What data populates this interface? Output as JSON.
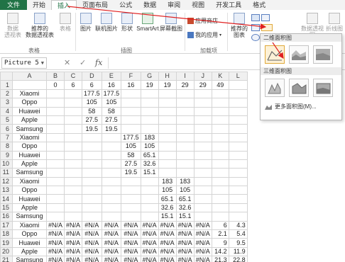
{
  "tabs": [
    "文件",
    "开始",
    "插入",
    "页面布局",
    "公式",
    "数据",
    "审阅",
    "视图",
    "开发工具",
    "格式"
  ],
  "ribbon": {
    "pivot_table": "数据\n透视表",
    "recommended_pivot": "推荐的\n数据透视表",
    "table": "表格",
    "picture": "图片",
    "online_picture": "联机图片",
    "shapes": "形状",
    "smartart": "SmartArt",
    "screenshot": "屏幕截图",
    "app_store": "应用商店",
    "my_apps": "我的应用",
    "recommended_charts": "推荐的\n图表",
    "pivot_chart": "数据透视图",
    "line": "折线图",
    "group_tables": "表格",
    "group_illustrations": "插图",
    "group_addins": "加载项"
  },
  "formula_bar": {
    "name_box": "Picture 5",
    "fx": "fx",
    "cancel": "✕",
    "confirm": "✓"
  },
  "panel": {
    "section_2d": "二维面积图",
    "section_3d": "三维面积图",
    "more": "更多面积图(M)..."
  },
  "sheet": {
    "columns": [
      "",
      "A",
      "B",
      "C",
      "D",
      "E",
      "F",
      "G",
      "H",
      "I",
      "J",
      "K",
      "L"
    ],
    "rows": [
      {
        "r": "1",
        "cells": [
          "",
          "0",
          "6",
          "6",
          "16",
          "16",
          "19",
          "19",
          "29",
          "29",
          "49",
          ""
        ]
      },
      {
        "r": "2",
        "cells": [
          "Xiaomi",
          "",
          "",
          "177.5",
          "177.5",
          "",
          "",
          "",
          "",
          "",
          "",
          ""
        ]
      },
      {
        "r": "3",
        "cells": [
          "Oppo",
          "",
          "",
          "105",
          "105",
          "",
          "",
          "",
          "",
          "",
          "",
          ""
        ]
      },
      {
        "r": "4",
        "cells": [
          "Huawei",
          "",
          "",
          "58",
          "58",
          "",
          "",
          "",
          "",
          "",
          "",
          ""
        ]
      },
      {
        "r": "5",
        "cells": [
          "Apple",
          "",
          "",
          "27.5",
          "27.5",
          "",
          "",
          "",
          "",
          "",
          "",
          ""
        ]
      },
      {
        "r": "6",
        "cells": [
          "Samsung",
          "",
          "",
          "19.5",
          "19.5",
          "",
          "",
          "",
          "",
          "",
          "",
          ""
        ]
      },
      {
        "r": "7",
        "cells": [
          "Xiaomi",
          "",
          "",
          "",
          "",
          "177.5",
          "183",
          "",
          "",
          "",
          "",
          ""
        ]
      },
      {
        "r": "8",
        "cells": [
          "Oppo",
          "",
          "",
          "",
          "",
          "105",
          "105",
          "",
          "",
          "",
          "",
          ""
        ]
      },
      {
        "r": "9",
        "cells": [
          "Huawei",
          "",
          "",
          "",
          "",
          "58",
          "65.1",
          "",
          "",
          "",
          "",
          ""
        ]
      },
      {
        "r": "10",
        "cells": [
          "Apple",
          "",
          "",
          "",
          "",
          "27.5",
          "32.6",
          "",
          "",
          "",
          "",
          ""
        ]
      },
      {
        "r": "11",
        "cells": [
          "Samsung",
          "",
          "",
          "",
          "",
          "19.5",
          "15.1",
          "",
          "",
          "",
          "",
          ""
        ]
      },
      {
        "r": "12",
        "cells": [
          "Xiaomi",
          "",
          "",
          "",
          "",
          "",
          "",
          "183",
          "183",
          "",
          "",
          ""
        ]
      },
      {
        "r": "13",
        "cells": [
          "Oppo",
          "",
          "",
          "",
          "",
          "",
          "",
          "105",
          "105",
          "",
          "",
          ""
        ]
      },
      {
        "r": "14",
        "cells": [
          "Huawei",
          "",
          "",
          "",
          "",
          "",
          "",
          "65.1",
          "65.1",
          "",
          "",
          ""
        ]
      },
      {
        "r": "15",
        "cells": [
          "Apple",
          "",
          "",
          "",
          "",
          "",
          "",
          "32.6",
          "32.6",
          "",
          "",
          ""
        ]
      },
      {
        "r": "16",
        "cells": [
          "Samsung",
          "",
          "",
          "",
          "",
          "",
          "",
          "15.1",
          "15.1",
          "",
          "",
          ""
        ]
      },
      {
        "r": "17",
        "cells": [
          "Xiaomi",
          "#N/A",
          "#N/A",
          "#N/A",
          "#N/A",
          "#N/A",
          "#N/A",
          "#N/A",
          "#N/A",
          "#N/A",
          "6",
          "4.3"
        ]
      },
      {
        "r": "18",
        "cells": [
          "Oppo",
          "#N/A",
          "#N/A",
          "#N/A",
          "#N/A",
          "#N/A",
          "#N/A",
          "#N/A",
          "#N/A",
          "#N/A",
          "2.1",
          "5.4"
        ]
      },
      {
        "r": "19",
        "cells": [
          "Huawei",
          "#N/A",
          "#N/A",
          "#N/A",
          "#N/A",
          "#N/A",
          "#N/A",
          "#N/A",
          "#N/A",
          "#N/A",
          "9",
          "9.5"
        ]
      },
      {
        "r": "20",
        "cells": [
          "Apple",
          "#N/A",
          "#N/A",
          "#N/A",
          "#N/A",
          "#N/A",
          "#N/A",
          "#N/A",
          "#N/A",
          "#N/A",
          "14.2",
          "11.9"
        ]
      },
      {
        "r": "21",
        "cells": [
          "Samsung",
          "#N/A",
          "#N/A",
          "#N/A",
          "#N/A",
          "#N/A",
          "#N/A",
          "#N/A",
          "#N/A",
          "#N/A",
          "21.3",
          "22.8"
        ]
      }
    ]
  },
  "colors": {
    "excel_green": "#217346",
    "annotation_red": "#e02020"
  }
}
